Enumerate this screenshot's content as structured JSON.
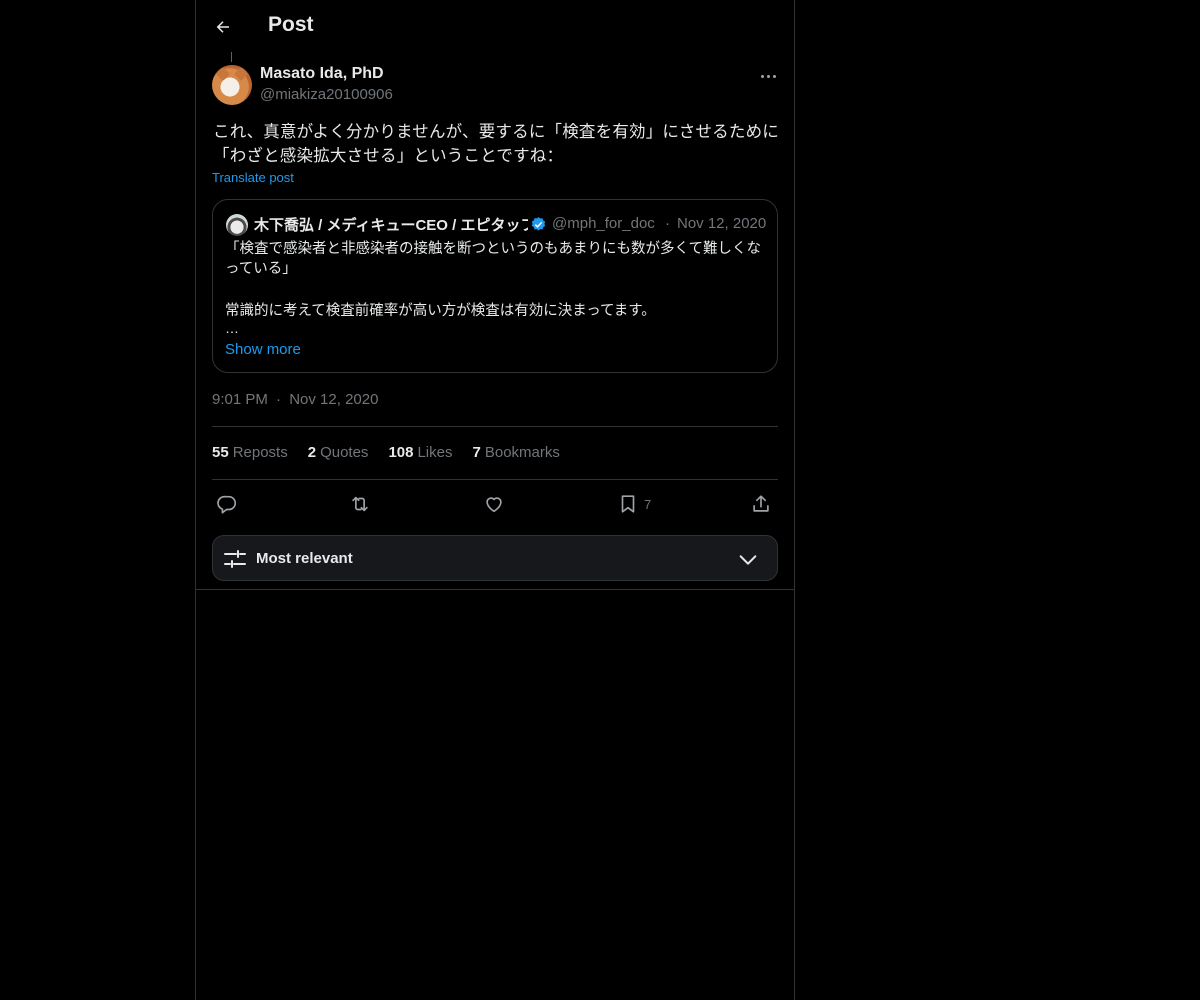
{
  "header": {
    "title": "Post"
  },
  "post": {
    "author_name": "Masato Ida, PhD",
    "author_handle": "@miakiza20100906",
    "text": "これ、真意がよく分かりませんが、要するに「検査を有効」にさせるために「わざと感染拡大させる」ということですね：",
    "translate_label": "Translate post",
    "timestamp": "9:01 PM",
    "date": "Nov 12, 2020",
    "separator": "·"
  },
  "quote": {
    "author_name": "木下喬弘 / メディキューCEO / エピタッフ",
    "author_handle": "@mph_for_doc",
    "separator": "·",
    "date": "Nov 12, 2020",
    "body": "「検査で感染者と非感染者の接触を断つというのもあまりにも数が多くて難しくなっている」",
    "line2": "常識的に考えて検査前確率が高い方が検査は有効に決まってます。",
    "ellipsis": "…",
    "show_more": "Show more"
  },
  "stats": {
    "reposts_count": "55",
    "reposts_label": "Reposts",
    "quotes_count": "2",
    "quotes_label": "Quotes",
    "likes_count": "108",
    "likes_label": "Likes",
    "bookmarks_count": "7",
    "bookmarks_label": "Bookmarks"
  },
  "actions": {
    "bookmark_count": "7"
  },
  "sort": {
    "label": "Most relevant"
  },
  "colors": {
    "accent": "#1d9bf0",
    "background": "#000000",
    "text": "#e7e9ea",
    "muted": "#71767b",
    "border": "#2f3336"
  },
  "icons": [
    "back-arrow-icon",
    "more-icon",
    "verified-icon",
    "reply-icon",
    "repost-icon",
    "like-icon",
    "bookmark-icon",
    "share-icon",
    "sliders-icon",
    "chevron-down-icon"
  ]
}
